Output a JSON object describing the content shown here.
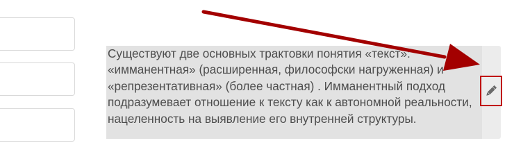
{
  "editor": {
    "text_lines": [
      "Существуют две основных трактовки понятия «текст»:",
      "«имманентная» (расширенная, философски нагруженная) и",
      "«репрезентативная» (более частная) . Имманентный подход",
      "подразумевает отношение к тексту как к автономной реальности,",
      "нацеленность на выявление его внутренней структуры."
    ],
    "edit_icon": "pencil-icon"
  },
  "colors": {
    "text": "#4d4d4d",
    "text_background": "#e2e2e2",
    "highlight": "#c00000",
    "arrow": "#a30000"
  }
}
